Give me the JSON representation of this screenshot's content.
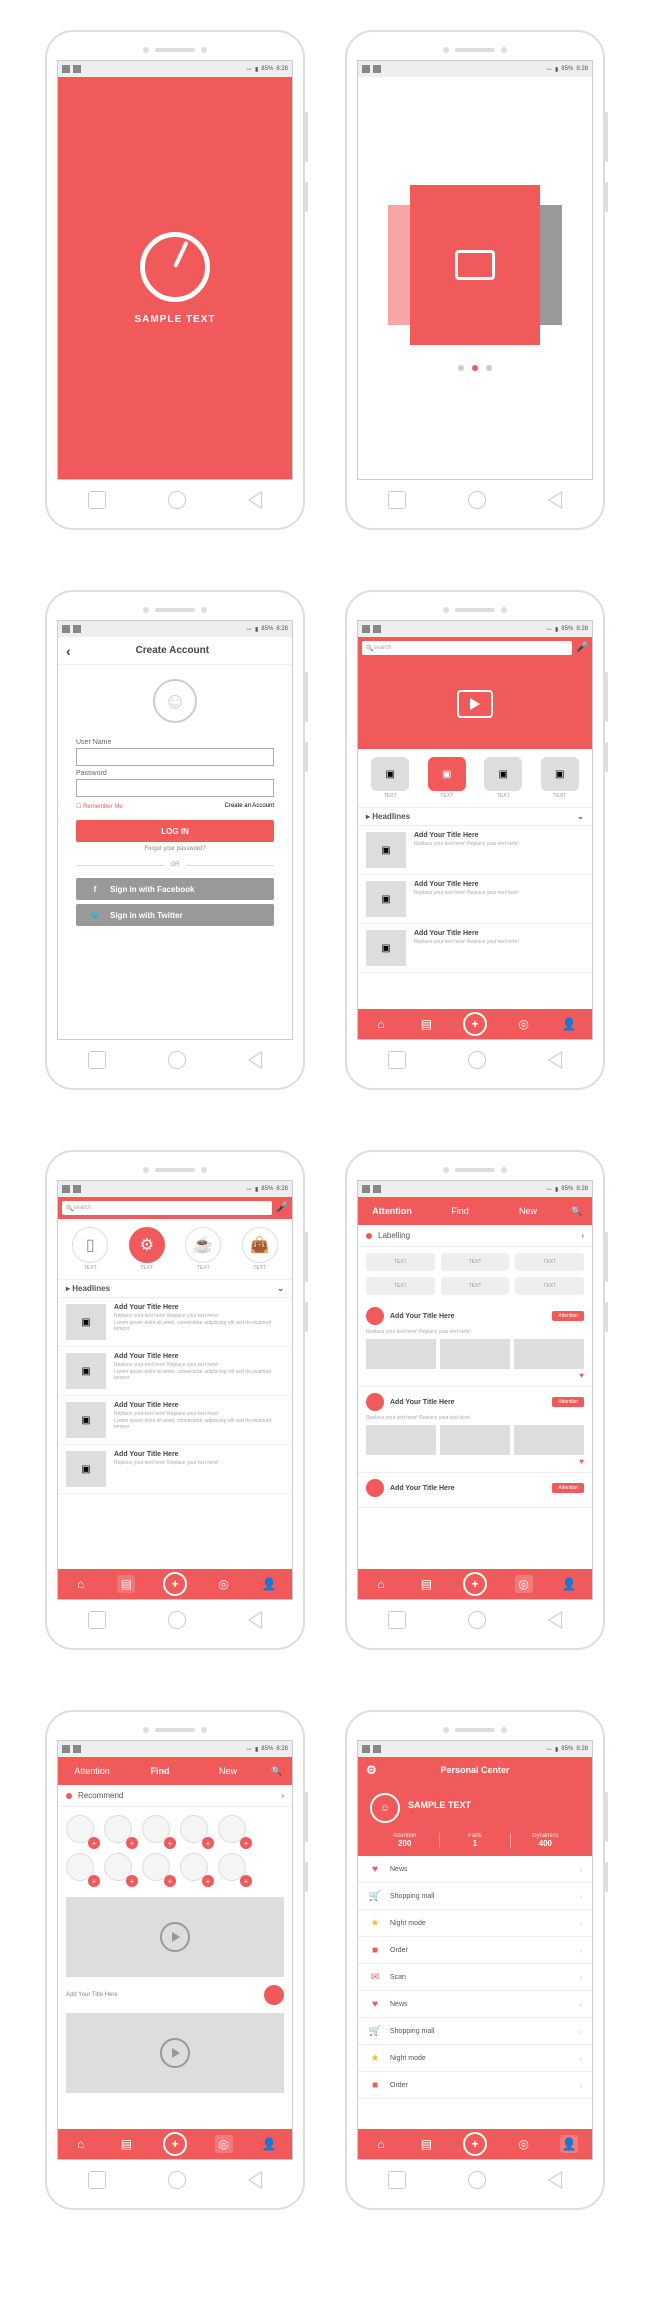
{
  "colors": {
    "accent": "#f05a5a",
    "grey": "#cccccc"
  },
  "statusbar": {
    "signal": "85%",
    "time": "8:28"
  },
  "splash": {
    "title": "SAMPLE TEXT"
  },
  "carousel": {
    "dots": 3,
    "active_dot": 1
  },
  "create_account": {
    "title": "Create Account",
    "username_label": "User Name",
    "password_label": "Password",
    "remember_label": "Remember Me",
    "create_link": "Create an Account",
    "login_button": "LOG IN",
    "forgot_link": "Forgot your password?",
    "or_label": "OR",
    "facebook_button": "Sign in with Facebook",
    "twitter_button": "Sign in with Twitter"
  },
  "home": {
    "search_placeholder": "search",
    "categories": [
      "TEXT",
      "TEXT",
      "TEXT",
      "TEXT"
    ],
    "active_category": 1,
    "headlines_title": "Headlines",
    "item_title": "Add Your Title Here",
    "item_subtitle": "Replace your text here! Replace your text here!",
    "item_body": "Lorem ipsum dolor sit amet, consectetur adipiscing elit sed do eiusmod tempor."
  },
  "tabs": {
    "attention": "Attention",
    "find": "Find",
    "new": "New"
  },
  "labelling": {
    "title": "Labelling",
    "pills": [
      "TEXT",
      "TEXT",
      "TEXT",
      "TEXT",
      "TEXT",
      "TEXT"
    ],
    "card_title": "Add Your Title Here",
    "card_desc": "Replace your text here! Replace your text here!",
    "badge": "Attention"
  },
  "recommend": {
    "title": "Recommend",
    "feed_title": "Add Your Title Here"
  },
  "personal_center": {
    "title": "Personal Center",
    "username": "SAMPLE TEXT",
    "stats": [
      {
        "label": "Attention",
        "value": "200"
      },
      {
        "label": "Fans",
        "value": "1"
      },
      {
        "label": "Dynamics",
        "value": "400"
      }
    ],
    "menu": [
      {
        "icon": "♥",
        "color": "#f05a5a",
        "label": "News"
      },
      {
        "icon": "🛒",
        "color": "#f0a03a",
        "label": "Shopping mall"
      },
      {
        "icon": "★",
        "color": "#f0c040",
        "label": "Night mode"
      },
      {
        "icon": "■",
        "color": "#f05a5a",
        "label": "Order"
      },
      {
        "icon": "✉",
        "color": "#f05a5a",
        "label": "Scan"
      },
      {
        "icon": "♥",
        "color": "#f05a5a",
        "label": "News"
      },
      {
        "icon": "🛒",
        "color": "#6aa84f",
        "label": "Shopping mall"
      },
      {
        "icon": "★",
        "color": "#f0c040",
        "label": "Night mode"
      },
      {
        "icon": "■",
        "color": "#f05a5a",
        "label": "Order"
      }
    ]
  },
  "bottom_nav": [
    "home-icon",
    "clipboard-icon",
    "plus-icon",
    "compass-icon",
    "user-icon"
  ]
}
